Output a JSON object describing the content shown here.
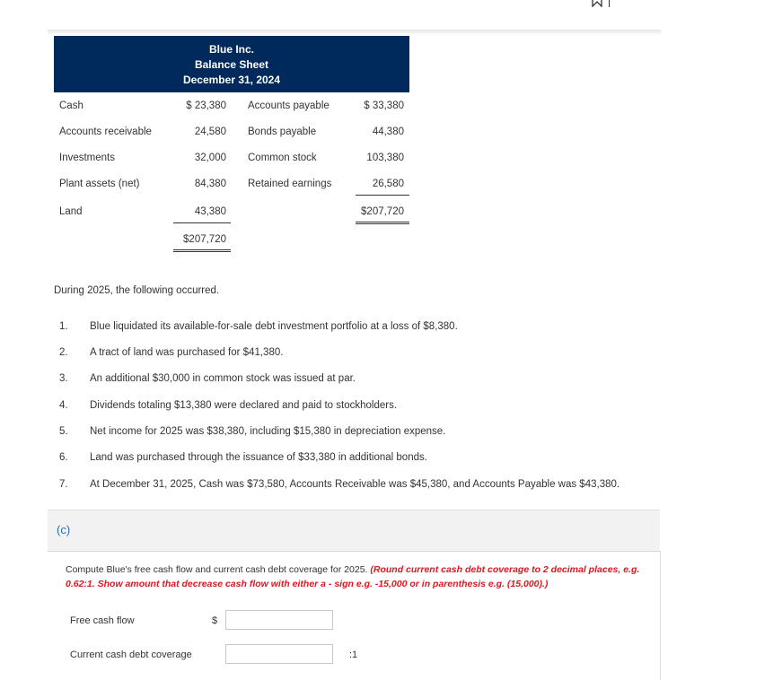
{
  "top_icons": {
    "bookmark_icon": "bookmark-icon",
    "partial_text": "(c)"
  },
  "balance_sheet": {
    "company": "Blue Inc.",
    "title": "Balance Sheet",
    "date": "December 31, 2024",
    "assets": [
      {
        "label": "Cash",
        "amount": "$ 23,380"
      },
      {
        "label": "Accounts receivable",
        "amount": "24,580"
      },
      {
        "label": "Investments",
        "amount": "32,000"
      },
      {
        "label": "Plant assets (net)",
        "amount": "84,380"
      },
      {
        "label": "Land",
        "amount": "43,380"
      }
    ],
    "assets_total": "$207,720",
    "liabilities_equity": [
      {
        "label": "Accounts payable",
        "amount": "$ 33,380"
      },
      {
        "label": "Bonds payable",
        "amount": "44,380"
      },
      {
        "label": "Common stock",
        "amount": "103,380"
      },
      {
        "label": "Retained earnings",
        "amount": "26,580"
      }
    ],
    "liabilities_equity_total": "$207,720"
  },
  "intro": "During 2025, the following occurred.",
  "events": [
    {
      "num": "1.",
      "text": "Blue liquidated its available-for-sale debt investment portfolio at a loss of $8,380."
    },
    {
      "num": "2.",
      "text": "A tract of land was purchased for $41,380."
    },
    {
      "num": "3.",
      "text": "An additional $30,000 in common stock was issued at par."
    },
    {
      "num": "4.",
      "text": "Dividends totaling $13,380 were declared and paid to stockholders."
    },
    {
      "num": "5.",
      "text": "Net income for 2025 was $38,380, including $15,380 in depreciation expense."
    },
    {
      "num": "6.",
      "text": "Land was purchased through the issuance of $33,380 in additional bonds."
    },
    {
      "num": "7.",
      "text": "At December 31, 2025, Cash was $73,580, Accounts Receivable was $45,380, and Accounts Payable was $43,380."
    }
  ],
  "part": {
    "label": "(c)",
    "instruction": "Compute Blue's free cash flow and current cash debt coverage for 2025. ",
    "instruction_note": "(Round current cash debt coverage to 2 decimal places, e.g. 0.62:1. Show amount that decrease cash flow with either a - sign e.g. -15,000 or in parenthesis e.g. (15,000).)",
    "fields": [
      {
        "label": "Free cash flow",
        "prefix": "$",
        "value": "",
        "suffix": ""
      },
      {
        "label": "Current cash debt coverage",
        "prefix": "",
        "value": "",
        "suffix": ":1"
      }
    ]
  },
  "colors": {
    "header_bg": "#002a5c",
    "accent_blue": "#2a6ebb",
    "note_red": "#e0171c"
  }
}
